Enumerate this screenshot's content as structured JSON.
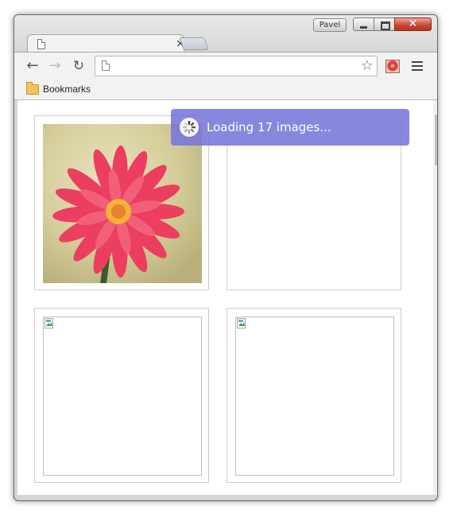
{
  "window": {
    "profile_name": "Pavel"
  },
  "tab": {
    "title": "",
    "close_glyph": "×"
  },
  "toolbar": {
    "back_glyph": "←",
    "forward_glyph": "→",
    "reload_glyph": "↻",
    "address_value": "",
    "star_glyph": "☆",
    "icons": [
      "page-icon",
      "star-icon",
      "extension-flower-icon",
      "menu-icon"
    ]
  },
  "bookmarks_bar": {
    "folder_label": "Bookmarks"
  },
  "content": {
    "images": [
      {
        "name": "flower-image",
        "state": "loaded"
      },
      {
        "name": "image-2",
        "state": "loading"
      },
      {
        "name": "image-3",
        "state": "broken"
      },
      {
        "name": "image-4",
        "state": "broken"
      }
    ]
  },
  "loading_toast": {
    "text": "Loading 17 images...",
    "icon": "spinner-icon",
    "background": "#7676d9"
  },
  "colors": {
    "close_button": "#c84432",
    "flower_pink": "#e93456",
    "flower_background": "#d7cf9c"
  }
}
